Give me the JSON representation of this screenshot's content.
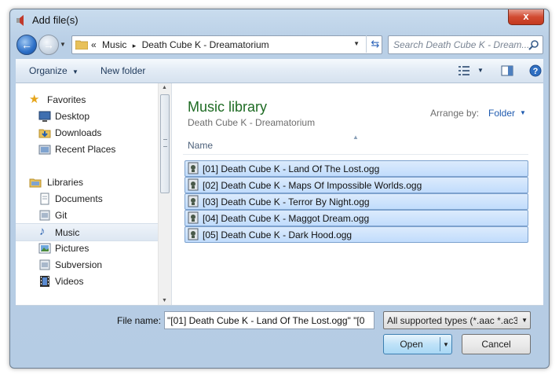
{
  "window": {
    "title": "Add file(s)",
    "close_glyph": "x"
  },
  "nav": {
    "back_glyph": "←",
    "address": {
      "overflow_glyph": "«",
      "segments": [
        "Music",
        "Death Cube K - Dreamatorium"
      ],
      "separator": "▸"
    },
    "search_placeholder": "Search Death Cube K - Dream..."
  },
  "toolbar": {
    "organize_label": "Organize",
    "new_folder_label": "New folder"
  },
  "sidebar": {
    "favorites_label": "Favorites",
    "favorites": [
      "Desktop",
      "Downloads",
      "Recent Places"
    ],
    "libraries_label": "Libraries",
    "libraries": [
      "Documents",
      "Git",
      "Music",
      "Pictures",
      "Subversion",
      "Videos"
    ],
    "selected": "Music"
  },
  "main": {
    "library_title": "Music library",
    "library_subtitle": "Death Cube K - Dreamatorium",
    "arrange_by_label": "Arrange by:",
    "arrange_by_value": "Folder",
    "column_name": "Name",
    "files": [
      "[01] Death Cube K - Land Of The Lost.ogg",
      "[02] Death Cube K - Maps Of Impossible Worlds.ogg",
      "[03] Death Cube K - Terror By Night.ogg",
      "[04] Death Cube K - Maggot Dream.ogg",
      "[05] Death Cube K - Dark Hood.ogg"
    ]
  },
  "footer": {
    "file_name_label": "File name:",
    "file_name_value": "\"[01] Death Cube K - Land Of The Lost.ogg\" \"[0",
    "file_type_value": "All supported types (*.aac *.ac3",
    "open_label": "Open",
    "cancel_label": "Cancel"
  },
  "colors": {
    "library_title": "#1e6b23",
    "selection_fill": "#c1dcfc",
    "selection_border": "#7da2ce",
    "link_blue": "#1e5aaf"
  }
}
